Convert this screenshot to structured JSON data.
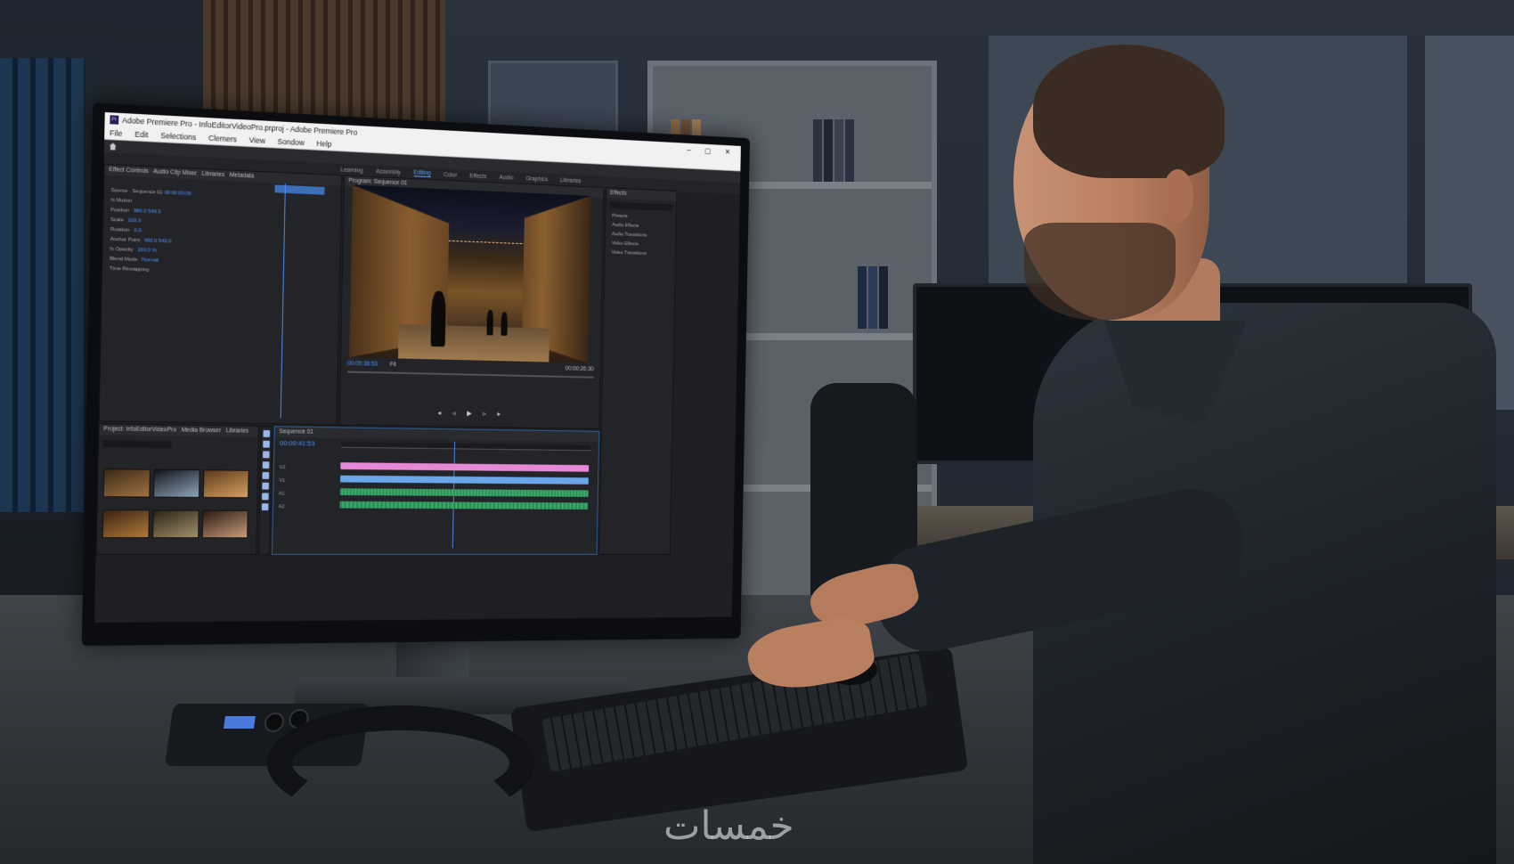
{
  "app": {
    "title": "Adobe Premiere Pro - InfoEditorVideoPro.prproj - Adobe Premiere Pro",
    "icon_label": "Pr",
    "menu": [
      "File",
      "Edit",
      "Selections",
      "Clemers",
      "View",
      "Sondow",
      "Help"
    ],
    "window_controls": "– ▢ ✕",
    "workspaces": [
      "Learning",
      "Assembly",
      "Editing",
      "Color",
      "Effects",
      "Audio",
      "Graphics",
      "Libraries"
    ],
    "active_workspace": "Editing"
  },
  "effect_controls": {
    "tabs": [
      "Effect Controls",
      "Audio Clip Mixer",
      "Libraries",
      "Metadata"
    ],
    "rows": [
      {
        "label": "Source · Sequence 01",
        "value": "00:00:00:00"
      },
      {
        "label": "fx Motion",
        "value": ""
      },
      {
        "label": "Position",
        "value": "960.0  540.0"
      },
      {
        "label": "Scale",
        "value": "100.0"
      },
      {
        "label": "Rotation",
        "value": "0.0"
      },
      {
        "label": "Anchor Point",
        "value": "960.0  540.0"
      },
      {
        "label": "fx Opacity",
        "value": "100.0 %"
      },
      {
        "label": "Blend Mode",
        "value": "Normal"
      },
      {
        "label": "Time Remapping",
        "value": ""
      }
    ]
  },
  "program_monitor": {
    "title": "Program: Sequence 01",
    "timecode_in": "00:00:38:53",
    "timecode_out": "00:00:26:30",
    "zoom": "Fit",
    "transport": "◂ ◃ ▶ ▹ ▸"
  },
  "project_panel": {
    "tabs": [
      "Project: InfoEditorVideoPro",
      "Media Browser",
      "Libraries"
    ],
    "items_count": 6
  },
  "timeline": {
    "title": "Sequence 01",
    "timecode": "00:00:41:53",
    "tracks": [
      {
        "name": "V2",
        "color": "#e68ad8"
      },
      {
        "name": "V1",
        "color": "#6aa6e8"
      },
      {
        "name": "A1",
        "color": "#3cae6b"
      },
      {
        "name": "A2",
        "color": "#3cae6b"
      }
    ]
  },
  "effects_panel": {
    "title": "Effects",
    "items": [
      "Presets",
      "Audio Effects",
      "Audio Transitions",
      "Video Effects",
      "Video Transitions"
    ]
  },
  "watermark": "خمسات"
}
